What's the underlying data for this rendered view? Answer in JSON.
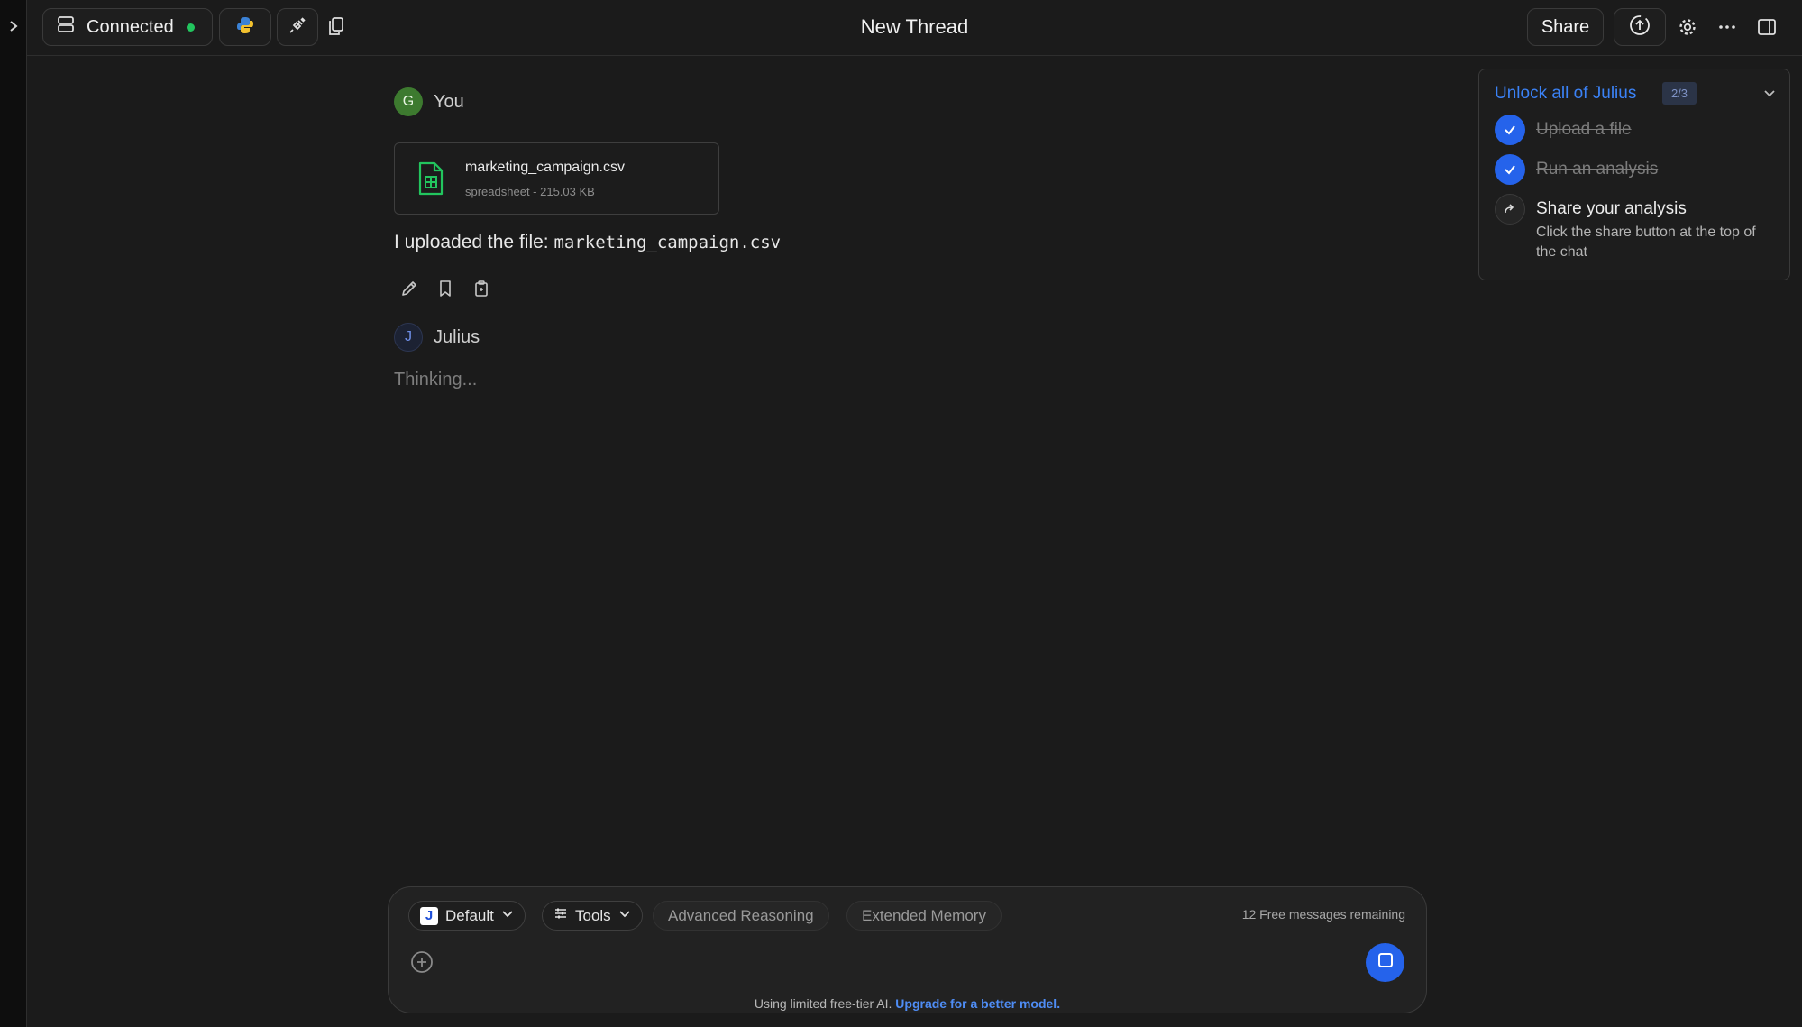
{
  "header": {
    "connection_label": "Connected",
    "title": "New Thread",
    "share_label": "Share"
  },
  "colors": {
    "accent": "#2563eb",
    "connected_dot": "#22c55e",
    "background": "#1b1b1b"
  },
  "icons": [
    "chevron-right-icon",
    "server-icon",
    "python-icon",
    "plug-icon",
    "copy-icon",
    "upload-icon",
    "gear-icon",
    "ellipsis-icon",
    "sidebar-panel-icon",
    "spreadsheet-icon",
    "pencil-icon",
    "bookmark-icon",
    "clipboard-icon",
    "check-icon",
    "share-arrow-icon",
    "chevron-down-icon",
    "sliders-icon",
    "plus-circle-icon",
    "stop-icon"
  ],
  "thread": {
    "user": {
      "avatar_letter": "G",
      "name": "You",
      "file": {
        "name": "marketing_campaign.csv",
        "meta": "spreadsheet - 215.03 KB"
      },
      "message_prefix": "I uploaded the file: ",
      "message_file": "marketing_campaign.csv"
    },
    "assistant": {
      "avatar_letter": "J",
      "name": "Julius",
      "status": "Thinking..."
    }
  },
  "unlock_panel": {
    "title": "Unlock all of Julius",
    "progress": "2/3",
    "steps": [
      {
        "label": "Upload a file",
        "done": true
      },
      {
        "label": "Run an analysis",
        "done": true
      },
      {
        "label": "Share your analysis",
        "done": false,
        "description": "Click the share button at the top of the chat"
      }
    ]
  },
  "composer": {
    "model_logo": "J",
    "model_label": "Default",
    "tools_label": "Tools",
    "advanced_reasoning_label": "Advanced Reasoning",
    "extended_memory_label": "Extended Memory",
    "free_messages": "12 Free messages remaining",
    "footer_prefix": "Using limited free-tier AI.",
    "footer_link": "Upgrade for a better model."
  }
}
